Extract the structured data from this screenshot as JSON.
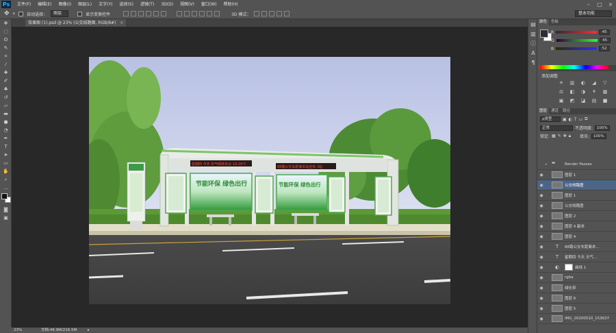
{
  "app": {
    "logo": "Ps"
  },
  "menu": [
    "文件(F)",
    "编辑(E)",
    "图像(I)",
    "图层(L)",
    "文字(Y)",
    "选择(S)",
    "滤镜(T)",
    "3D(D)",
    "视图(V)",
    "窗口(W)",
    "帮助(H)"
  ],
  "window_controls": [
    "–",
    "□",
    "×"
  ],
  "options": {
    "auto_select_label": "自动选择：",
    "auto_select_value": "图层",
    "show_transform_label": "显示变换控件",
    "mode3d_label": "3D 模式：",
    "workspace": "基本功能"
  },
  "document": {
    "tab_title": "效果图 (1).psd @ 23% (公交线路图, RGB/8#)",
    "tab_close": "×",
    "sign_left": "星期四 今天 天气晴转多云 18-26℃",
    "sign_right": "88路公交车距离本站还有 3站",
    "poster_slogan": "节能环保 绿色出行"
  },
  "status": {
    "zoom": "23%",
    "doc_size": "文档:46.9M/216.5M",
    "arrow": "▸"
  },
  "color_panel": {
    "tabs": [
      "颜色",
      "色板"
    ],
    "channels": [
      {
        "label": "R",
        "value": "45",
        "grad": "#2d2d34,#ff2d34"
      },
      {
        "label": "G",
        "value": "45",
        "grad": "#2d0034,#2dff34"
      },
      {
        "label": "B",
        "value": "52",
        "grad": "#2d2d00,#2d2dff"
      }
    ],
    "fg_color": "#2d2d34"
  },
  "adjust_panel": {
    "tabs": [
      "调整",
      "样式"
    ],
    "title": "添加调整",
    "icons": [
      "☀",
      "▥",
      "◐",
      "◢",
      "▽",
      "⚖",
      "◧",
      "◑",
      "⚘",
      "▦",
      "▣",
      "◩",
      "◪",
      "▤",
      "■"
    ]
  },
  "layers_panel": {
    "tabs": [
      "图层",
      "通道",
      "路径"
    ],
    "filter_label": "ρ类型",
    "blend_mode": "正常",
    "opacity_label": "不透明度:",
    "opacity": "100%",
    "lock_label": "锁定:",
    "fill_label": "填充:",
    "fill": "100%",
    "layers": [
      {
        "name": "Render Passes",
        "type": "folder",
        "visible": false
      },
      {
        "name": "图层 1",
        "type": "pixel",
        "visible": true
      },
      {
        "name": "公交线路图",
        "type": "smart",
        "visible": true,
        "selected": true
      },
      {
        "name": "图层 1",
        "type": "pixel",
        "visible": true
      },
      {
        "name": "公交线路图",
        "type": "smart",
        "visible": true
      },
      {
        "name": "图层 2",
        "type": "pixel",
        "visible": true
      },
      {
        "name": "图层 4 副本",
        "type": "pixel",
        "visible": true
      },
      {
        "name": "图层 4",
        "type": "pixel",
        "visible": true
      },
      {
        "name": "88路公交车距离本...",
        "type": "text",
        "visible": true
      },
      {
        "name": "星期四 今天 天气...",
        "type": "text",
        "visible": true
      },
      {
        "name": "曲线 1",
        "type": "adjust",
        "visible": true
      },
      {
        "name": "rgba",
        "type": "pixel",
        "visible": true
      },
      {
        "name": "绿化带",
        "type": "pixel",
        "visible": true
      },
      {
        "name": "图层 6",
        "type": "pixel",
        "visible": true
      },
      {
        "name": "图层 5",
        "type": "pixel",
        "visible": true
      },
      {
        "name": "IMG_20200510_153637",
        "type": "pixel",
        "visible": true
      }
    ]
  }
}
